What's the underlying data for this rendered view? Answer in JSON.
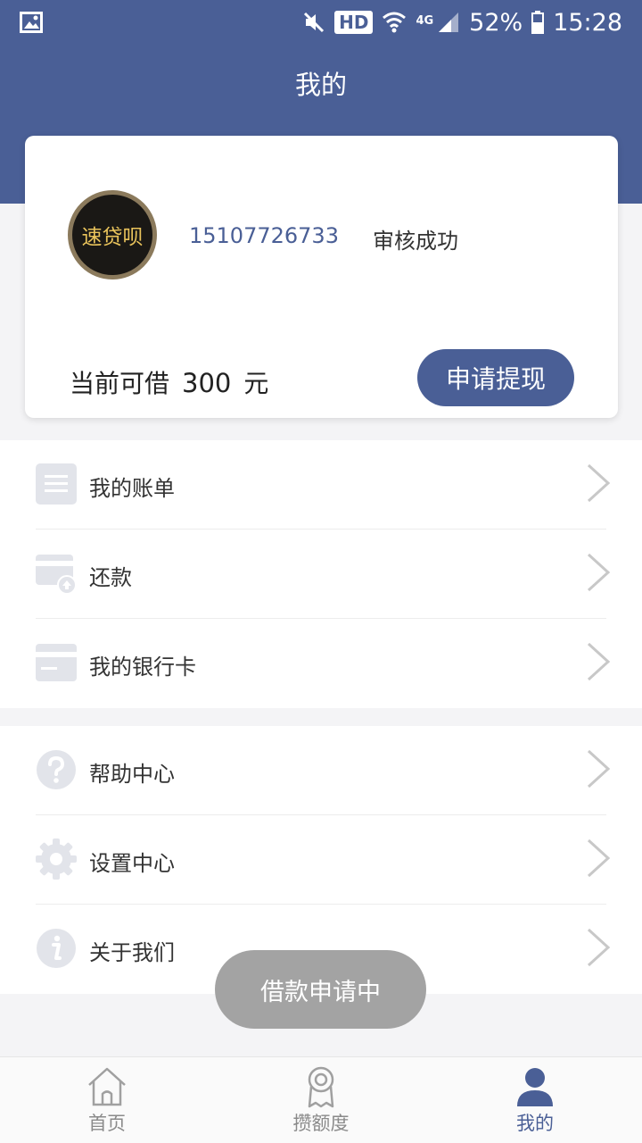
{
  "status_bar": {
    "network_type": "4G",
    "hd_label": "HD",
    "battery": "52%",
    "time": "15:28"
  },
  "header": {
    "title": "我的"
  },
  "profile": {
    "avatar_text": "速贷呗",
    "phone": "15107726733",
    "review_status": "审核成功",
    "quota_label": "当前可借",
    "quota_amount": "300",
    "quota_unit": "元",
    "withdraw_label": "申请提现"
  },
  "menu_group_1": [
    {
      "label": "我的账单",
      "icon": "bill-icon"
    },
    {
      "label": "还款",
      "icon": "repayment-card-icon"
    },
    {
      "label": "我的银行卡",
      "icon": "bank-card-icon"
    }
  ],
  "menu_group_2": [
    {
      "label": "帮助中心",
      "icon": "help-icon"
    },
    {
      "label": "设置中心",
      "icon": "gear-icon"
    },
    {
      "label": "关于我们",
      "icon": "info-icon"
    }
  ],
  "toast": {
    "message": "借款申请中"
  },
  "tabs": [
    {
      "label": "首页",
      "icon": "home-icon",
      "active": false
    },
    {
      "label": "攒额度",
      "icon": "medal-icon",
      "active": false
    },
    {
      "label": "我的",
      "icon": "user-icon",
      "active": true
    }
  ],
  "colors": {
    "primary": "#4a5f96",
    "icon_gray": "#e2e4ea",
    "toast_bg": "#a3a3a3"
  }
}
